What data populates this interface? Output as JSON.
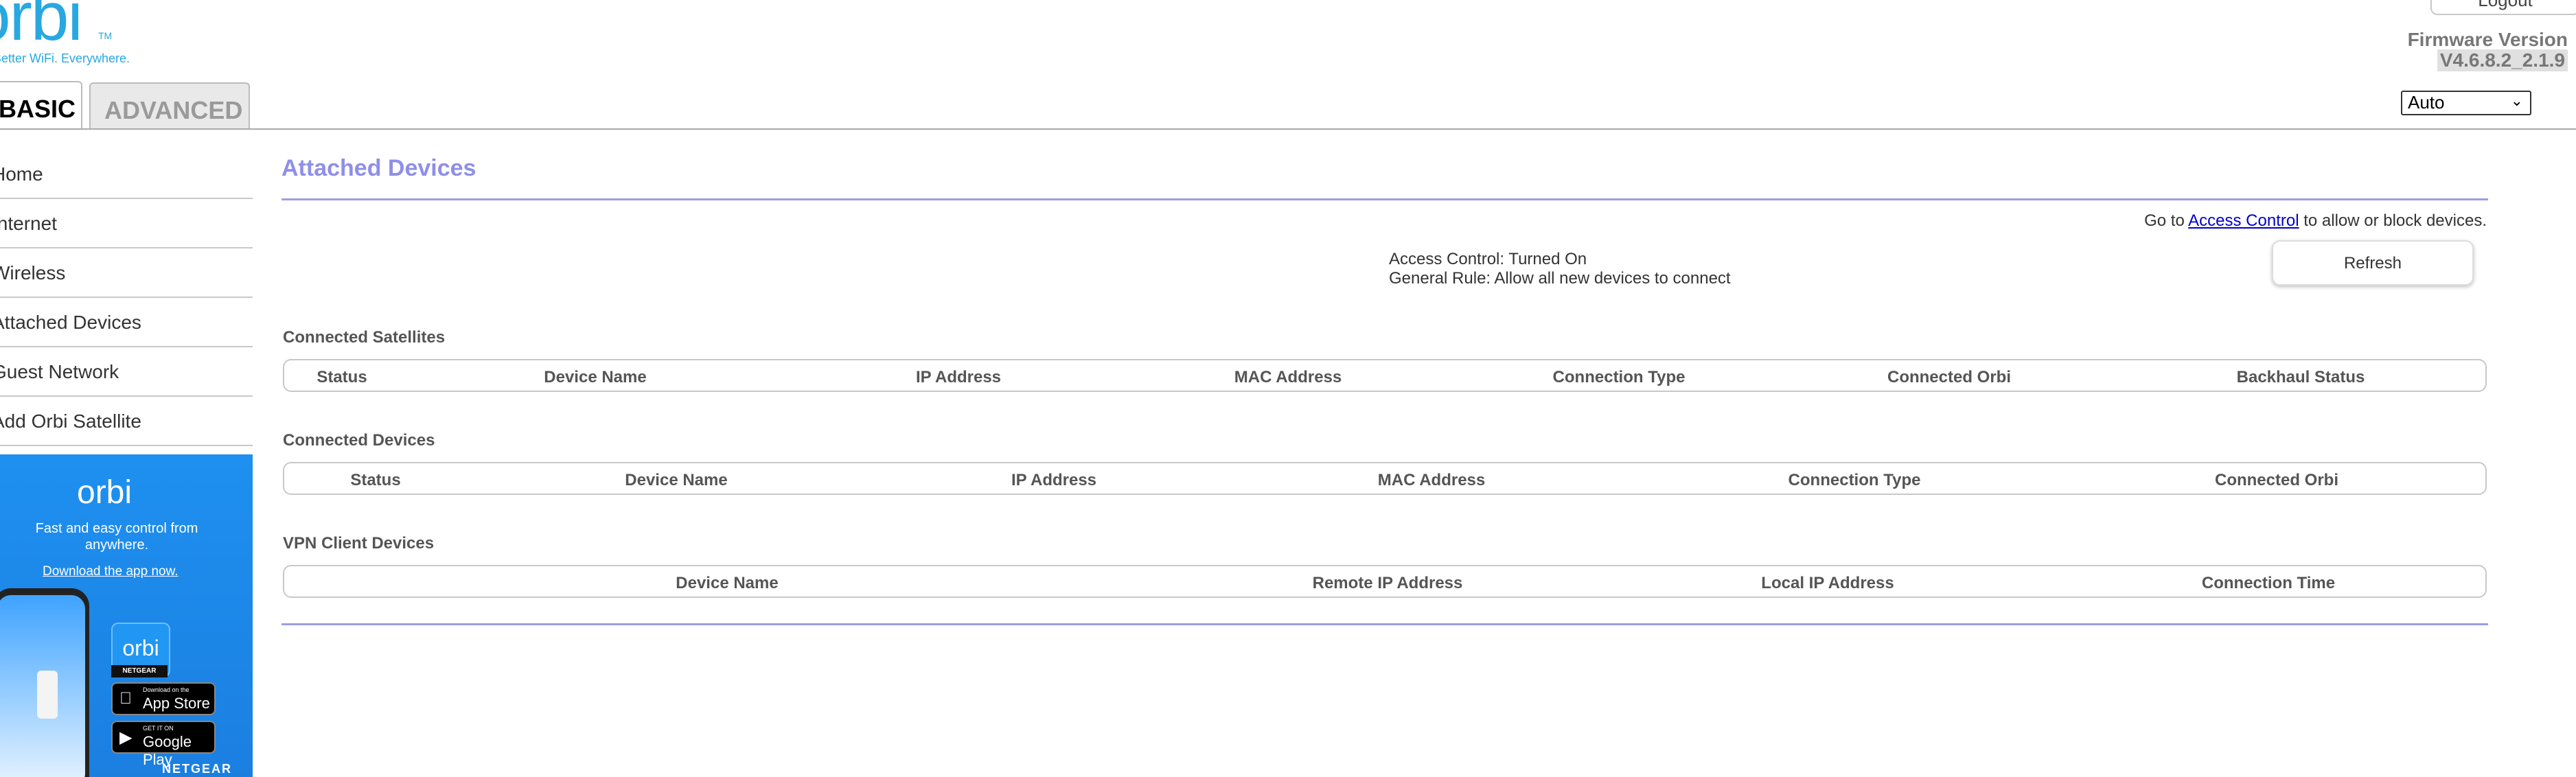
{
  "header": {
    "logo": "orbi",
    "logo_tm": "TM",
    "tagline": "Better WiFi. Everywhere.",
    "logout_label": "Logout",
    "firmware_label": "Firmware Version",
    "firmware_version": "V4.6.8.2_2.1.9",
    "language_selected": "Auto"
  },
  "tabs": {
    "basic": "BASIC",
    "advanced": "ADVANCED"
  },
  "sidebar": {
    "items": [
      {
        "label": "Home"
      },
      {
        "label": "Internet"
      },
      {
        "label": "Wireless"
      },
      {
        "label": "Attached Devices"
      },
      {
        "label": "Guest Network"
      },
      {
        "label": "Add Orbi Satellite"
      }
    ]
  },
  "promo": {
    "logo": "orbi",
    "text": "Fast and easy control from anywhere.",
    "link": "Download the app now.",
    "app_icon": "orbi",
    "badge": "NETGEAR",
    "app_store_small": "Download on the",
    "app_store_big": "App Store",
    "google_play_small": "GET IT ON",
    "google_play_big": "Google Play",
    "brand": "NETGEAR"
  },
  "main": {
    "title": "Attached Devices",
    "access_note_prefix": "Go to ",
    "access_note_link": "Access Control",
    "access_note_suffix": " to allow or block devices.",
    "access_control_status": "Access Control: Turned On",
    "general_rule": "General Rule: Allow all new devices to connect",
    "refresh_label": "Refresh",
    "satellites": {
      "title": "Connected Satellites",
      "columns": [
        "Status",
        "Device Name",
        "IP Address",
        "MAC Address",
        "Connection Type",
        "Connected Orbi",
        "Backhaul Status"
      ]
    },
    "devices": {
      "title": "Connected Devices",
      "columns": [
        "Status",
        "Device Name",
        "IP Address",
        "MAC Address",
        "Connection Type",
        "Connected Orbi"
      ]
    },
    "vpn": {
      "title": "VPN Client Devices",
      "columns": [
        "Device Name",
        "Remote IP Address",
        "Local IP Address",
        "Connection Time"
      ]
    }
  }
}
